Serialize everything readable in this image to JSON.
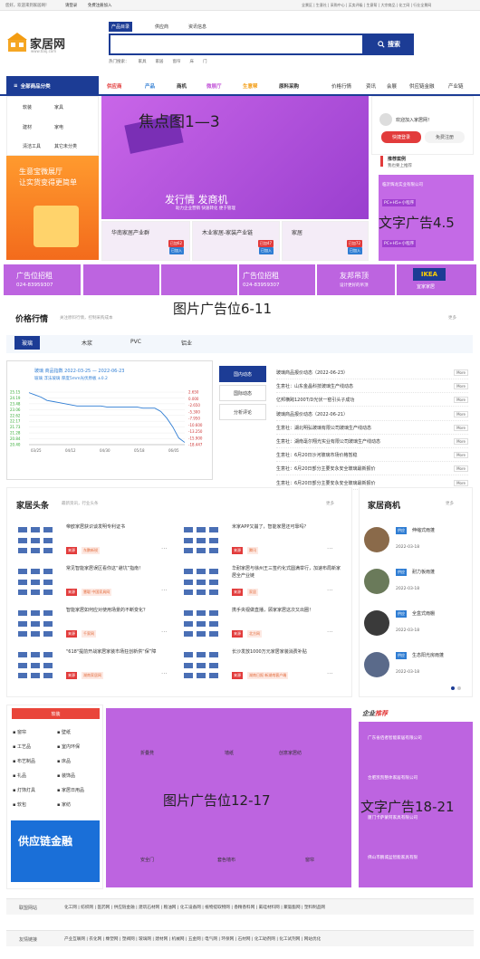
{
  "topbar": {
    "welcome": "您好，欢迎来到家居网！",
    "login": "请登录",
    "register": "免费注册加入",
    "right_links": "全景区 | 生意社 | 采购中心 | 买卖评级 | 生意帮 | 大宗商品 | 化工网 | 行业全景网"
  },
  "logo": {
    "title": "家居网",
    "sub": "www.tooj.com"
  },
  "search": {
    "tabs": [
      "产品目录",
      "供应商",
      "资讯信息"
    ],
    "button": "搜索",
    "hot_label": "热门搜索：",
    "hot": [
      "家具",
      "家居",
      "窗帘",
      "床",
      "门"
    ]
  },
  "nav": {
    "category_head": "全部商品分类",
    "items": [
      {
        "label": "供应商",
        "color": "#e23b3b"
      },
      {
        "label": "产品",
        "color": "#2f7dd3"
      },
      {
        "label": "商机",
        "color": "#333333"
      },
      {
        "label": "微展厅",
        "color": "#c45ad9"
      },
      {
        "label": "生意帮",
        "color": "#f39c12"
      },
      {
        "label": "原料采购",
        "color": "#333333"
      },
      {
        "label": "价格行情",
        "color": "#333333"
      },
      {
        "label": "资讯",
        "color": "#333333"
      },
      {
        "label": "会展",
        "color": "#333333"
      },
      {
        "label": "供应链金融",
        "color": "#333333"
      },
      {
        "label": "产业链",
        "color": "#333333"
      }
    ]
  },
  "categories": [
    "软装",
    "家具",
    "建材",
    "家电",
    "清洁工具",
    "其它未分类"
  ],
  "promo": {
    "line1": "生意宝微展厅",
    "line2": "让实货变得更简单"
  },
  "focus": {
    "label": "焦点图1—3",
    "slogan": "发行情 发商机",
    "sub": "助力企业营销 快速转化 便于管理"
  },
  "cards": [
    {
      "title": "华南家居产业群",
      "badge1": "已加62",
      "badge2": "已加入"
    },
    {
      "title": "木业家居-家装产业链",
      "badge1": "已加47",
      "badge2": "已加入"
    },
    {
      "title": "家居",
      "badge1": "已加72",
      "badge2": "已加入"
    }
  ],
  "user": {
    "welcome": "欢迎加入家居网！",
    "login": "快捷登录",
    "register": "免费注册",
    "rec_title": "推荐案例",
    "rec_sub": "我也要上推荐"
  },
  "text_ad": {
    "label": "文字广告4.5",
    "line1": "临沂辉龙实业有限公司",
    "line2": "PC+H5+小程序"
  },
  "ad_strip": {
    "label": "图片广告位6-11",
    "cell1": "广告位招租",
    "cell1_phone": "024-83959307",
    "cell2": "广告位招租",
    "cell2_phone": "024-83959307",
    "youbang": "友邦吊顶",
    "youbang_sub": "设计更好的吊顶",
    "ikea": "IKEA",
    "ikea_sub": "宜家家居"
  },
  "price": {
    "title": "价格行情",
    "sub": "关注原料行情，控制采购成本",
    "more": "更多",
    "tabs": [
      "玻璃",
      "木浆",
      "PVC",
      "铝业"
    ],
    "side_tabs": [
      "国内动态",
      "国际动态",
      "分析评论"
    ]
  },
  "chart_data": {
    "type": "line",
    "title": "玻璃 商品指数 2022-03-25 — 2022-06-23",
    "legend": "玻璃 浮法玻璃 厚度5mm光伏原板 ±0.2",
    "x": [
      "03/25",
      "04/12",
      "04/30",
      "05/18",
      "06/05"
    ],
    "yticks_left": [
      "25.15",
      "24.19",
      "23.48",
      "23.06",
      "22.62",
      "22.17",
      "21.73",
      "21.28",
      "20.84",
      "20.40"
    ],
    "yticks_right": [
      "2.650",
      "0.000",
      "-2.650",
      "-5.300",
      "-7.950",
      "-10.600",
      "-13.250",
      "-15.900",
      "-18.447"
    ],
    "series": [
      {
        "values": [
          25.1,
          24.9,
          24.7,
          24.4,
          24.3,
          24.2,
          24.1,
          24.0,
          23.9,
          23.9,
          23.9,
          23.9,
          23.9,
          23.8,
          23.8,
          23.8,
          23.8,
          23.8,
          23.8,
          23.7,
          23.7,
          23.7,
          23.4,
          22.8,
          22.0,
          21.0,
          20.6
        ]
      }
    ]
  },
  "price_news": [
    {
      "text": "玻璃商品报价动态（2022-06-23）",
      "more": "More"
    },
    {
      "text": "生意社：山东金晶科技玻璃生产线动态",
      "more": "More"
    },
    {
      "text": "亿邦横跨1200T/D光伏一窑引头子成功",
      "more": "More"
    },
    {
      "text": "玻璃商品报价动态（2022-06-21）",
      "more": "More"
    },
    {
      "text": "生意社：湖北明弘玻璃有限公司玻璃生产线动态",
      "more": "More"
    },
    {
      "text": "生意社：湖南毫尔翔光实业有限公司玻璃生产线动态",
      "more": "More"
    },
    {
      "text": "生意社：6月20日沙河玻璃市场价格暂稳",
      "more": "More"
    },
    {
      "text": "生意社：6月20日部分主要安永安全玻璃最新报价",
      "more": "More"
    },
    {
      "text": "生意社：6月20日部分主要安永安全玻璃最新报价",
      "more": "More"
    }
  ],
  "headlines": {
    "title": "家居头条",
    "sub": "最新资讯，行业头条",
    "more": "更多",
    "items": [
      {
        "title": "帝欧家居获识谈发明专利证书",
        "tag1": "来源",
        "tag2": "东鹏新锐"
      },
      {
        "title": "米家APP又崩了，智能家居还可靠吗？",
        "tag1": "来源",
        "tag2": "腾讯"
      },
      {
        "title": "常见智能家居误区看你这“避坑”指南！",
        "tag1": "来源",
        "tag2": "慧聪 中国家具网"
      },
      {
        "title": "华耐家居与徐州王三签约化式圆满举行，加速布局新家居全产业链",
        "tag1": "来源",
        "tag2": "家居"
      },
      {
        "title": "智能家居如何应对使用场景的不断变化？",
        "tag1": "来源",
        "tag2": "千家网"
      },
      {
        "title": "携手央视做直播，顾家家居这次又出圈！",
        "tag1": "来源",
        "tag2": "北方网"
      },
      {
        "title": "\"618\"提前开战家居家装市场狂创新供“保”障",
        "tag1": "来源",
        "tag2": "湖南家居网"
      },
      {
        "title": "长沙发放1000万元家居家装消费补贴",
        "tag1": "来源",
        "tag2": "湖南日报 新湖南客户端"
      }
    ]
  },
  "business": {
    "title": "家居商机",
    "more": "更多",
    "items": [
      {
        "tag": "供应",
        "name": "伸缩式雨蓬",
        "date": "2022-03-18"
      },
      {
        "tag": "供应",
        "name": "耐力板雨蓬",
        "date": "2022-03-18"
      },
      {
        "tag": "供应",
        "name": "全盒式雨棚",
        "date": "2022-03-18"
      },
      {
        "tag": "供应",
        "name": "生态阳光房雨蓬",
        "date": "2022-03-18"
      }
    ]
  },
  "materials": {
    "head": "软装",
    "items": [
      "窗帘",
      "壁纸",
      "工艺品",
      "室内环保",
      "布艺制品",
      "床品",
      "礼品",
      "装饰品",
      "灯饰灯具",
      "家居日用品",
      "软包",
      "家纺"
    ],
    "promo": "供应链金融"
  },
  "img_ad2": {
    "label": "图片广告位12-17",
    "caps": [
      "折叠凳",
      "墙纸",
      "创意家居纺",
      "安全门",
      "套色墙布",
      "窗帘"
    ]
  },
  "biz_recommend": {
    "title": "企业",
    "title_hl": "推荐",
    "label": "文字广告18-21",
    "items": [
      "广东省佰者智能家居有限公司",
      "合肥凯凯整体家居有限公司",
      "厦门卡萨蒙阿家具有限公司",
      "佛山市鹏城盆智能家具有限"
    ]
  },
  "footer": {
    "links1_label": "联盟网站",
    "links1": "化工网 | 纺织网 | 医药网 | 供应链金融 | 建筑石材网 | 粮油网 | 化工设备网 | 植物提取物网 | 香精香料网 | 氟硅材料网 | 聚氨酯网 | 塑料制品网",
    "links2_label": "友情链接",
    "links2": "产业互联网 | 农化网 | 橡塑网 | 塑阀网 | 玻璃网 | 建材网 | 机械网 | 五金网 | 电气网 | 环保网 | 石材网 | 化工助剂网 | 化工试剂网 | 网站优化"
  }
}
